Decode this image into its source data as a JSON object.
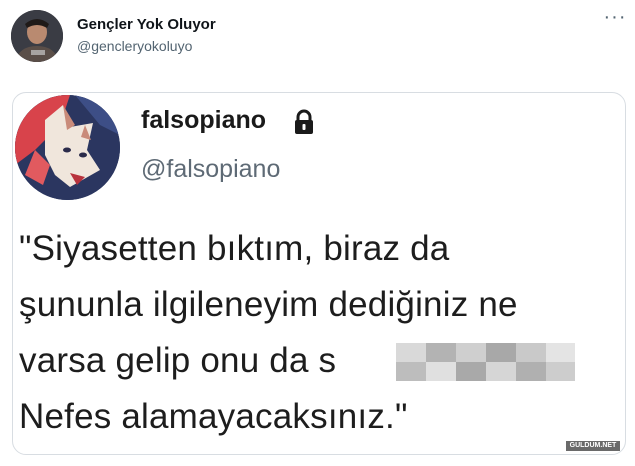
{
  "tweet": {
    "author_name": "Gençler Yok Oluyor",
    "author_handle": "@gencleryokoluyo",
    "more_icon": "more-options-icon",
    "more_label": "···"
  },
  "quoted": {
    "author_name": "falsopiano",
    "author_handle": "@falsopiano",
    "lock_icon": "lock-icon",
    "lines": [
      "\"Siyasetten bıktım, biraz da",
      "şununla ilgileneyim dediğiniz ne",
      "varsa gelip onu da s",
      "Nefes alamayacaksınız.\""
    ]
  },
  "watermark": "GULDUM.NET"
}
